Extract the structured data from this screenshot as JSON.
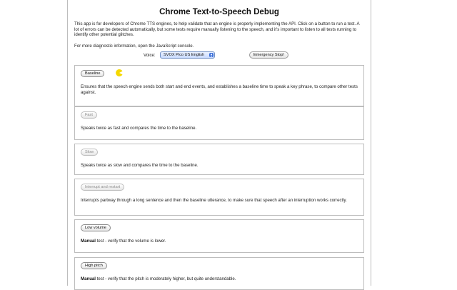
{
  "title": "Chrome Text-to-Speech Debug",
  "intro": "This app is for developers of Chrome TTS engines, to help validate that an engine is properly implementing the API. Click on a button to run a test. A lot of errors can be detected automatically, but some tests require manually listening to the speech, and it's important to listen to all tests running to identify other potential glitches.",
  "diagnostic": "For more diagnostic information, open the JavaScript console.",
  "voice": {
    "label": "Voice:",
    "selected": "SVOX Pico US English"
  },
  "emergency_stop_label": "Emergency Stop!",
  "tests": [
    {
      "button": "Baseline",
      "description": "Ensures that the speech engine sends both start and end events, and establishes a baseline time to speak a key phrase, to compare other tests against.",
      "running_icon": "pacman-icon"
    },
    {
      "button": "Fast",
      "description": "Speaks twice as fast and compares the time to the baseline."
    },
    {
      "button": "Slow",
      "description": "Speaks twice as slow and compares the time to the baseline."
    },
    {
      "button": "Interrupt and restart",
      "description": "Interrupts partway through a long sentence and then the baseline utterance, to make sure that speech after an interruption works correctly."
    },
    {
      "button": "Low volume",
      "description_bold": "Manual",
      "description": " test - verify that the volume is lower."
    },
    {
      "button": "High pitch",
      "description_bold": "Manual",
      "description": " test - verify that the pitch is moderately higher, but quite understandable."
    }
  ],
  "colors": {
    "running_icon": "#f5d800",
    "select_accent": "#3b6fd8"
  }
}
